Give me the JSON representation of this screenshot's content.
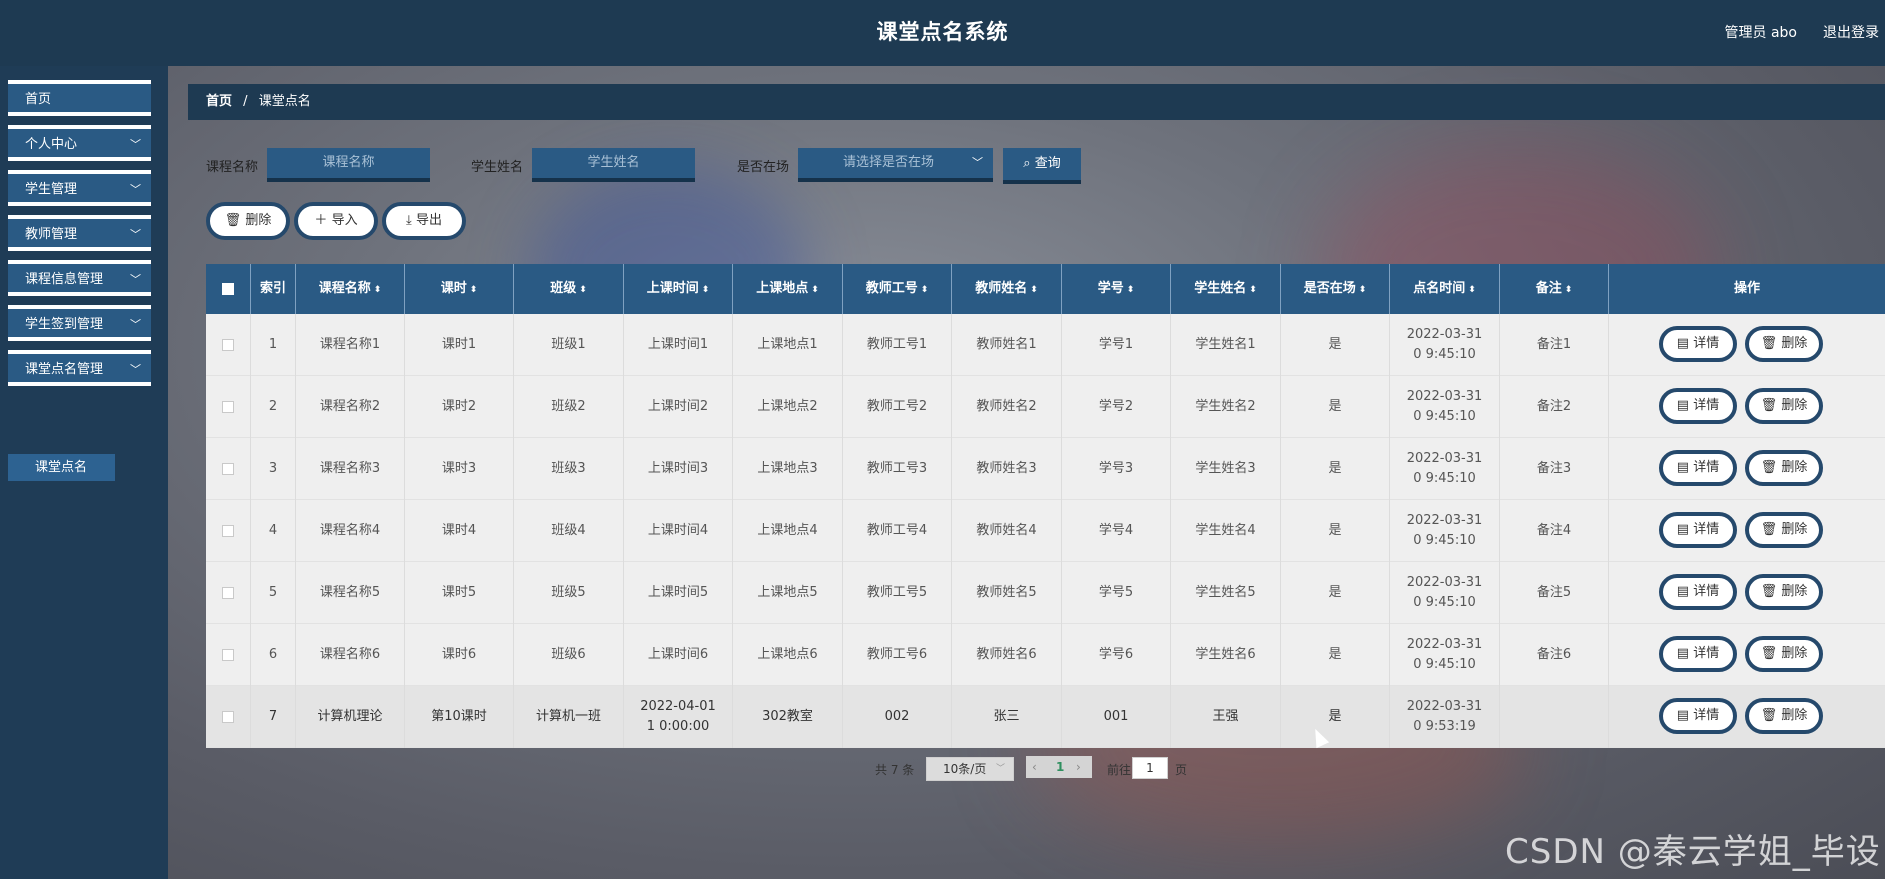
{
  "header": {
    "title": "课堂点名系统",
    "admin": "管理员 abo",
    "logout": "退出登录"
  },
  "sidebar": {
    "items": [
      {
        "label": "首页",
        "chevron": ""
      },
      {
        "label": "个人中心",
        "chevron": "﹀"
      },
      {
        "label": "学生管理",
        "chevron": "﹀"
      },
      {
        "label": "教师管理",
        "chevron": "﹀"
      },
      {
        "label": "课程信息管理",
        "chevron": "﹀"
      },
      {
        "label": "学生签到管理",
        "chevron": "﹀"
      },
      {
        "label": "课堂点名管理",
        "chevron": "﹀"
      }
    ],
    "subitem": "课堂点名"
  },
  "breadcrumb": {
    "home": "首页",
    "sep": "/",
    "current": "课堂点名"
  },
  "filters": {
    "course_label": "课程名称",
    "course_placeholder": "课程名称",
    "student_label": "学生姓名",
    "student_placeholder": "学生姓名",
    "present_label": "是否在场",
    "present_placeholder": "请选择是否在场",
    "query_label": "查询",
    "query_icon": "search-icon"
  },
  "actions": {
    "delete": "删除",
    "import": "导入",
    "export": "导出"
  },
  "table": {
    "headers": [
      "索引",
      "课程名称",
      "课时",
      "班级",
      "上课时间",
      "上课地点",
      "教师工号",
      "教师姓名",
      "学号",
      "学生姓名",
      "是否在场",
      "点名时间",
      "备注",
      "操作"
    ],
    "rows": [
      {
        "idx": "1",
        "course": "课程名称1",
        "lesson": "课时1",
        "cls": "班级1",
        "time": "上课时间1",
        "place": "上课地点1",
        "tno": "教师工号1",
        "tname": "教师姓名1",
        "sno": "学号1",
        "sname": "学生姓名1",
        "present": "是",
        "calltime": "2022-03-31 0 9:45:10",
        "note": "备注1"
      },
      {
        "idx": "2",
        "course": "课程名称2",
        "lesson": "课时2",
        "cls": "班级2",
        "time": "上课时间2",
        "place": "上课地点2",
        "tno": "教师工号2",
        "tname": "教师姓名2",
        "sno": "学号2",
        "sname": "学生姓名2",
        "present": "是",
        "calltime": "2022-03-31 0 9:45:10",
        "note": "备注2"
      },
      {
        "idx": "3",
        "course": "课程名称3",
        "lesson": "课时3",
        "cls": "班级3",
        "time": "上课时间3",
        "place": "上课地点3",
        "tno": "教师工号3",
        "tname": "教师姓名3",
        "sno": "学号3",
        "sname": "学生姓名3",
        "present": "是",
        "calltime": "2022-03-31 0 9:45:10",
        "note": "备注3"
      },
      {
        "idx": "4",
        "course": "课程名称4",
        "lesson": "课时4",
        "cls": "班级4",
        "time": "上课时间4",
        "place": "上课地点4",
        "tno": "教师工号4",
        "tname": "教师姓名4",
        "sno": "学号4",
        "sname": "学生姓名4",
        "present": "是",
        "calltime": "2022-03-31 0 9:45:10",
        "note": "备注4"
      },
      {
        "idx": "5",
        "course": "课程名称5",
        "lesson": "课时5",
        "cls": "班级5",
        "time": "上课时间5",
        "place": "上课地点5",
        "tno": "教师工号5",
        "tname": "教师姓名5",
        "sno": "学号5",
        "sname": "学生姓名5",
        "present": "是",
        "calltime": "2022-03-31 0 9:45:10",
        "note": "备注5"
      },
      {
        "idx": "6",
        "course": "课程名称6",
        "lesson": "课时6",
        "cls": "班级6",
        "time": "上课时间6",
        "place": "上课地点6",
        "tno": "教师工号6",
        "tname": "教师姓名6",
        "sno": "学号6",
        "sname": "学生姓名6",
        "present": "是",
        "calltime": "2022-03-31 0 9:45:10",
        "note": "备注6"
      },
      {
        "idx": "7",
        "course": "计算机理论",
        "lesson": "第10课时",
        "cls": "计算机一班",
        "time": "2022-04-01 1 0:00:00",
        "place": "302教室",
        "tno": "002",
        "tname": "张三",
        "sno": "001",
        "sname": "王强",
        "present": "是",
        "calltime": "2022-03-31 0 9:53:19",
        "note": ""
      }
    ],
    "op_detail": "详情",
    "op_delete": "删除"
  },
  "pagination": {
    "total": "共 7 条",
    "page_size": "10条/页",
    "current_page": "1",
    "goto_label": "前往",
    "goto_value": "1",
    "page_unit": "页",
    "prev": "‹",
    "next": "›"
  },
  "watermark": "CSDN @秦云学姐_毕设",
  "colors": {
    "header_bg": "#1e3a52",
    "accent": "#2a5a84",
    "pill_border": "#25496c",
    "active_page": "#2f8f5f"
  }
}
